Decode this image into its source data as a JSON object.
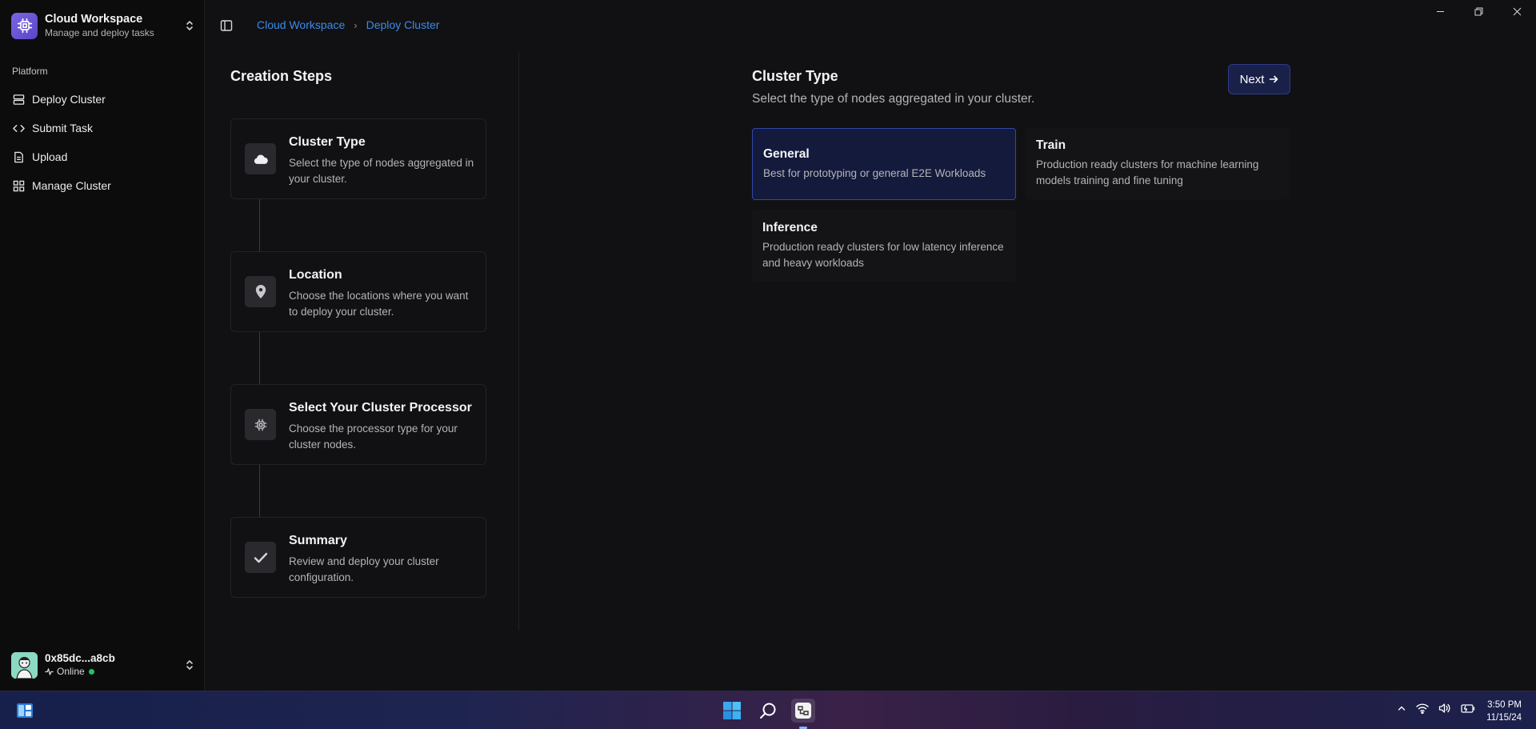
{
  "workspace": {
    "title": "Cloud Workspace",
    "subtitle": "Manage and deploy tasks"
  },
  "sidebar": {
    "section_label": "Platform",
    "items": [
      {
        "label": "Deploy Cluster",
        "icon": "server-icon"
      },
      {
        "label": "Submit Task",
        "icon": "code-icon"
      },
      {
        "label": "Upload",
        "icon": "file-icon"
      },
      {
        "label": "Manage Cluster",
        "icon": "grid-icon"
      }
    ]
  },
  "user": {
    "name": "0x85dc...a8cb",
    "status": "Online"
  },
  "breadcrumb": {
    "items": [
      "Cloud Workspace",
      "Deploy Cluster"
    ]
  },
  "steps": {
    "title": "Creation Steps",
    "items": [
      {
        "title": "Cluster Type",
        "desc": "Select the type of nodes aggregated in your cluster.",
        "icon": "cloud-icon"
      },
      {
        "title": "Location",
        "desc": "Choose the locations where you want to deploy your cluster.",
        "icon": "map-pin-icon"
      },
      {
        "title": "Select Your Cluster Processor",
        "desc": "Choose the processor type for your cluster nodes.",
        "icon": "cpu-icon"
      },
      {
        "title": "Summary",
        "desc": "Review and deploy your cluster configuration.",
        "icon": "check-icon"
      }
    ]
  },
  "main": {
    "title": "Cluster Type",
    "subtitle": "Select the type of nodes aggregated in your cluster.",
    "next_label": "Next",
    "options": [
      {
        "name": "General",
        "desc": "Best for prototyping or general E2E Workloads",
        "selected": true
      },
      {
        "name": "Train",
        "desc": "Production ready clusters for machine learning models training and fine tuning",
        "selected": false
      },
      {
        "name": "Inference",
        "desc": "Production ready clusters for low latency inference and heavy workloads",
        "selected": false
      }
    ]
  },
  "taskbar": {
    "time": "3:50 PM",
    "date": "11/15/24"
  },
  "colors": {
    "accent_link": "#3b8bea",
    "selected_card_bg": "#141a3c",
    "selected_card_border": "#3147a8",
    "status_online": "#22c55e",
    "logo_purple": "#6b55d8"
  }
}
